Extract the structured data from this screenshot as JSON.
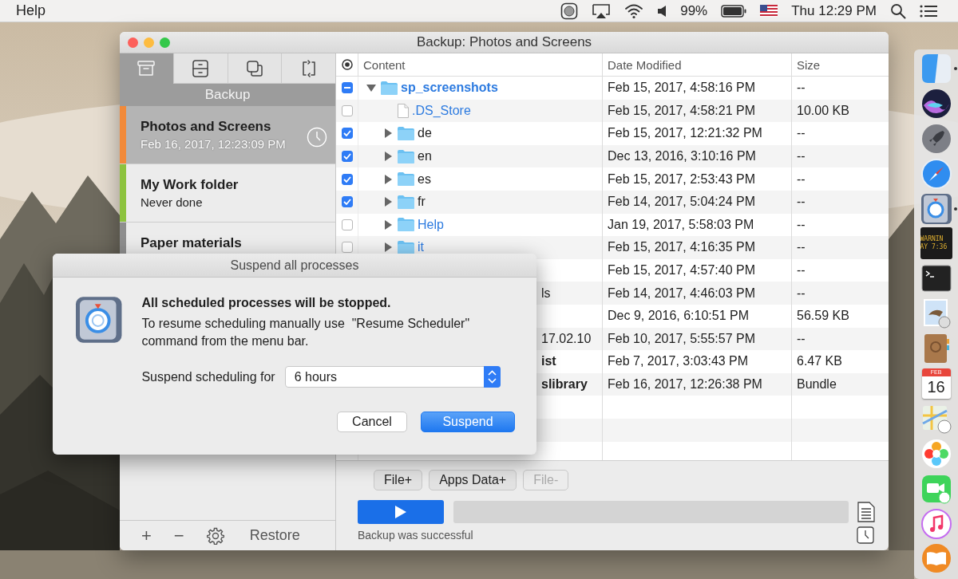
{
  "menu_bar": {
    "menus": [
      "Help"
    ],
    "battery_percent": "99%",
    "clock": "Thu 12:29 PM"
  },
  "window": {
    "title": "Backup: Photos and Screens"
  },
  "sidebar": {
    "tabs": [
      {
        "kind": "archive",
        "selected": true
      },
      {
        "kind": "cabinet",
        "selected": false
      },
      {
        "kind": "copy",
        "selected": false
      },
      {
        "kind": "sync",
        "selected": false
      }
    ],
    "section_title": "Backup",
    "items": [
      {
        "name": "Photos and Screens",
        "detail": "Feb 16, 2017, 12:23:09 PM",
        "color": "#f28a3a",
        "selected": true,
        "scheduled": true
      },
      {
        "name": "My Work folder",
        "detail": "Never done",
        "color": "#8dc33f",
        "selected": false,
        "scheduled": false
      },
      {
        "name": "Paper materials",
        "color": "#8e8e8e",
        "selected": false,
        "scheduled": false
      }
    ],
    "toolbar": {
      "add": "+",
      "remove": "−",
      "restore": "Restore"
    }
  },
  "table": {
    "columns": [
      "Content",
      "Date Modified",
      "Size"
    ],
    "rows": [
      {
        "kind": "folder",
        "name": "sp_screenshots",
        "color": "#2d7be0",
        "bold": true,
        "expanded": true,
        "checked": true,
        "mixed": true,
        "date": "Feb 15, 2017, 4:58:16 PM",
        "size": "--",
        "children": [
          {
            "kind": "file",
            "name": ".DS_Store",
            "color": "#2d7be0",
            "bold": false,
            "checked": false,
            "mixed": false,
            "date": "Feb 15, 2017, 4:58:21 PM",
            "size": "10.00 KB"
          },
          {
            "kind": "folder",
            "name": "de",
            "color": "#1e1e1e",
            "bold": false,
            "expanded": false,
            "checked": true,
            "mixed": false,
            "date": "Feb 15, 2017, 12:21:32 PM",
            "size": "--"
          },
          {
            "kind": "folder",
            "name": "en",
            "color": "#1e1e1e",
            "bold": false,
            "expanded": false,
            "checked": true,
            "mixed": false,
            "date": "Dec 13, 2016, 3:10:16 PM",
            "size": "--"
          },
          {
            "kind": "folder",
            "name": "es",
            "color": "#1e1e1e",
            "bold": false,
            "expanded": false,
            "checked": true,
            "mixed": false,
            "date": "Feb 15, 2017, 2:53:43 PM",
            "size": "--"
          },
          {
            "kind": "folder",
            "name": "fr",
            "color": "#1e1e1e",
            "bold": false,
            "expanded": false,
            "checked": true,
            "mixed": false,
            "date": "Feb 14, 2017, 5:04:24 PM",
            "size": "--"
          },
          {
            "kind": "folder",
            "name": "Help",
            "color": "#2d7be0",
            "bold": false,
            "expanded": false,
            "checked": false,
            "mixed": false,
            "date": "Jan 19, 2017, 5:58:03 PM",
            "size": "--"
          },
          {
            "kind": "folder",
            "name": "it",
            "color": "#2d7be0",
            "bold": false,
            "expanded": false,
            "checked": false,
            "mixed": false,
            "date": "Feb 15, 2017, 4:16:35 PM",
            "size": "--"
          },
          {
            "kind": "hidden",
            "date": "Feb 15, 2017, 4:57:40 PM",
            "size": "--"
          },
          {
            "kind": "clipped",
            "name": "ls",
            "color": "#1e1e1e",
            "bold": false,
            "date": "Feb 14, 2017, 4:46:03 PM",
            "size": "--"
          },
          {
            "kind": "hidden",
            "date": "Dec 9, 2016, 6:10:51 PM",
            "size": "56.59 KB"
          },
          {
            "kind": "clipped",
            "name": "17.02.10",
            "color": "#1e1e1e",
            "bold": false,
            "date": "Feb 10, 2017, 5:55:57 PM",
            "size": "--"
          },
          {
            "kind": "clipped",
            "name": "ist",
            "color": "#1e1e1e",
            "bold": true,
            "date": "Feb 7, 2017, 3:03:43 PM",
            "size": "6.47 KB"
          },
          {
            "kind": "clipped",
            "name": "slibrary",
            "color": "#1e1e1e",
            "bold": true,
            "date": "Feb 16, 2017, 12:26:38 PM",
            "size": "Bundle"
          }
        ]
      }
    ]
  },
  "actions": {
    "buttons": [
      {
        "label": "File+",
        "disabled": false
      },
      {
        "label": "Apps Data+",
        "disabled": false
      },
      {
        "label": "File-",
        "disabled": true
      }
    ],
    "progress": {
      "level": 0
    },
    "status": "Backup was successful"
  },
  "dialog": {
    "title": "Suspend all processes",
    "heading": "All scheduled processes will be stopped.",
    "message": "To resume scheduling manually use  \"Resume Scheduler\" command from the menu bar.",
    "duration_label": "Suspend scheduling for",
    "duration": "6 hours",
    "buttons": [
      {
        "label": "Cancel",
        "default": false
      },
      {
        "label": "Suspend",
        "default": true
      }
    ]
  },
  "dock": {
    "items": [
      {
        "kind": "split",
        "running": true
      },
      {
        "kind": "orb",
        "running": false
      },
      {
        "kind": "rocket",
        "running": false
      },
      {
        "kind": "compass",
        "running": false
      },
      {
        "kind": "safe",
        "running": true
      },
      {
        "kind": "console",
        "running": false,
        "lines": [
          "WARNIN",
          "AY 7:36"
        ]
      },
      {
        "kind": "terminal",
        "running": false
      },
      {
        "kind": "stamp",
        "running": false
      },
      {
        "kind": "contacts",
        "running": false
      },
      {
        "kind": "calendar",
        "running": false,
        "lines": [
          "FEB",
          "16"
        ]
      },
      {
        "kind": "map",
        "running": false
      },
      {
        "kind": "flower",
        "running": false
      },
      {
        "kind": "videophone",
        "running": false
      },
      {
        "kind": "music",
        "running": false
      },
      {
        "kind": "book",
        "running": false
      }
    ]
  }
}
